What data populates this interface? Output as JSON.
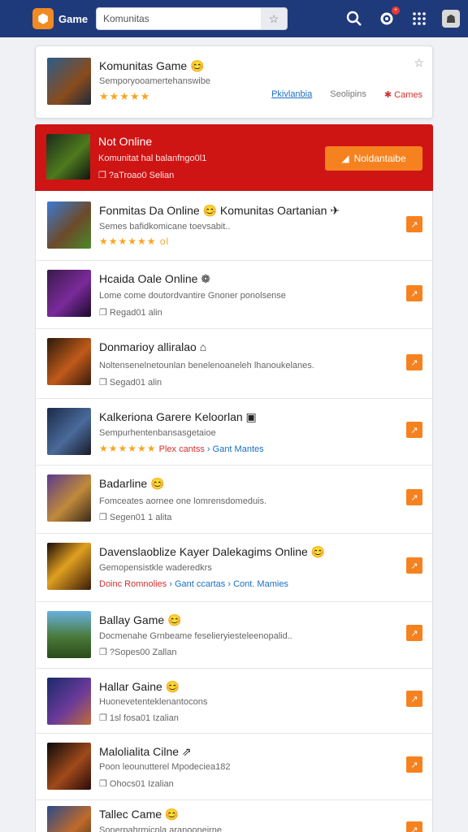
{
  "header": {
    "brand": "Game",
    "search_value": "Komunitas",
    "search_placeholder": "Komunitas",
    "notification_count": "+",
    "accent": "#1f3a7a"
  },
  "featured": {
    "title": "Komunitas Game 😊",
    "subtitle": "Semporyooamertehanswibe",
    "stars": "★★★★★",
    "link_1": "Pkivlanbia",
    "link_2": "Seolipins",
    "link_3": "✱ Cames"
  },
  "highlight": {
    "title": "Not Online",
    "subtitle": "Komunitat hal balanfngo0l1",
    "meta": "❐ ?aTroao0 Selian",
    "button": "Noldantaibe",
    "bg_color": "#cf1414"
  },
  "rows": [
    {
      "title": "Fonmitas Da Online 😊 Komunitas Oartanian ✈",
      "sub": "Semes bafidkomicane toevsabit..",
      "meta": "★★★★★★ ol"
    },
    {
      "title": "Hcaida Oale Online ❁",
      "sub": "Lome come doutordvantire Gnoner ponolsense",
      "meta": "❐ Regad01 alin"
    },
    {
      "title": "Donmarioy alliralao ⌂",
      "sub": "Noltensenelnetounlan benelenoaneleh lhanoukelanes.",
      "meta": "❐ Segad01 alin"
    },
    {
      "title": "Kalkeriona Garere Keloorlan ▣",
      "sub": "Sempurhentenbansasgetaioe",
      "meta_stars": "★★★★★★",
      "meta_tag1": "Plex cantss",
      "meta_tag2": "› Gant Mantes"
    },
    {
      "title": "Badarline 😊",
      "sub": "Fomceates aornee one lomrensdomeduis.",
      "meta": "❐ Segen01 1 alita"
    },
    {
      "title": "Davenslaoblize Kayer Dalekagims Online 😊",
      "sub": "Gemopensistkle waderedkrs",
      "meta_tag0": "Doinc Romnolies",
      "meta_tag1": "› Gant ccartas",
      "meta_tag2": "› Cont. Mamies"
    },
    {
      "title": "Ballay Game 😊",
      "sub": "Docmenahe Grnbeame feselieryiesteleenopalid..",
      "meta": "❐ ?Sopes00 Zallan"
    },
    {
      "title": "Hallar Gaine 😊",
      "sub": "Huonevetenteklenantocons",
      "meta": "❐ 1sl fosa01 Izalian"
    },
    {
      "title": "Malolialita Cilne ⇗",
      "sub": "Poon leounutterel Mpodeciea182",
      "meta": "❐ Ohocs01 Izalian"
    },
    {
      "title": "Tallec Came 😊",
      "sub": "Sonerpahrmicnla aranooneirne",
      "meta": ""
    }
  ]
}
